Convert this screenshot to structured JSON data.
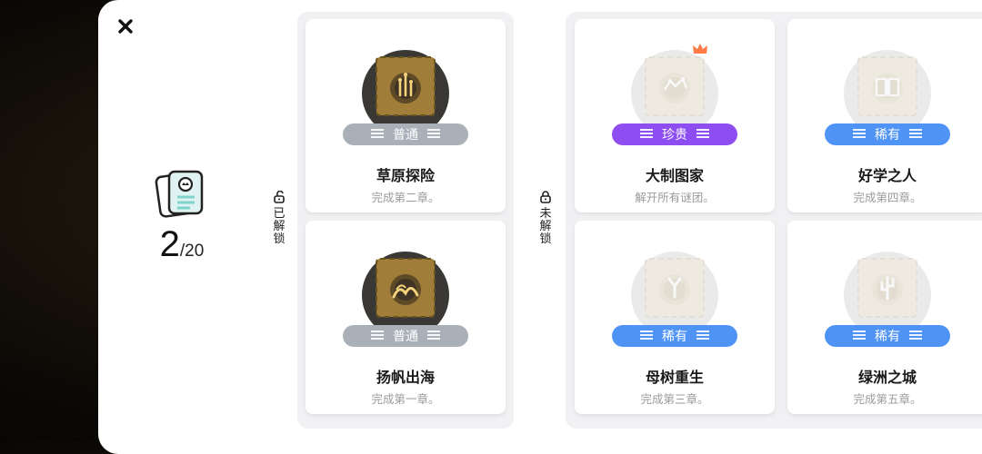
{
  "progress": {
    "count": "2",
    "total": "/20"
  },
  "sections": {
    "unlocked_label": [
      "已",
      "解",
      "锁"
    ],
    "locked_label": [
      "未",
      "解",
      "锁"
    ]
  },
  "cards": [
    {
      "title": "草原探险",
      "desc": "完成第二章。",
      "rarity": "普通",
      "rarity_color": "#a9b0b8",
      "state": "unlocked",
      "emblem": "sprout"
    },
    {
      "title": "扬帆出海",
      "desc": "完成第一章。",
      "rarity": "普通",
      "rarity_color": "#a9b0b8",
      "state": "unlocked",
      "emblem": "wave"
    },
    {
      "title": "大制图家",
      "desc": "解开所有谜团。",
      "rarity": "珍贵",
      "rarity_color": "#8e4df0",
      "state": "locked",
      "emblem": "map",
      "crown": true
    },
    {
      "title": "母树重生",
      "desc": "完成第三章。",
      "rarity": "稀有",
      "rarity_color": "#4f94f5",
      "state": "locked",
      "emblem": "tree"
    },
    {
      "title": "好学之人",
      "desc": "完成第四章。",
      "rarity": "稀有",
      "rarity_color": "#4f94f5",
      "state": "locked",
      "emblem": "book"
    },
    {
      "title": "绿洲之城",
      "desc": "完成第五章。",
      "rarity": "稀有",
      "rarity_color": "#4f94f5",
      "state": "locked",
      "emblem": "cactus"
    }
  ],
  "colors": {
    "common": "#a9b0b8",
    "precious": "#8e4df0",
    "rare": "#4f94f5",
    "crown": "#ff7a45"
  }
}
